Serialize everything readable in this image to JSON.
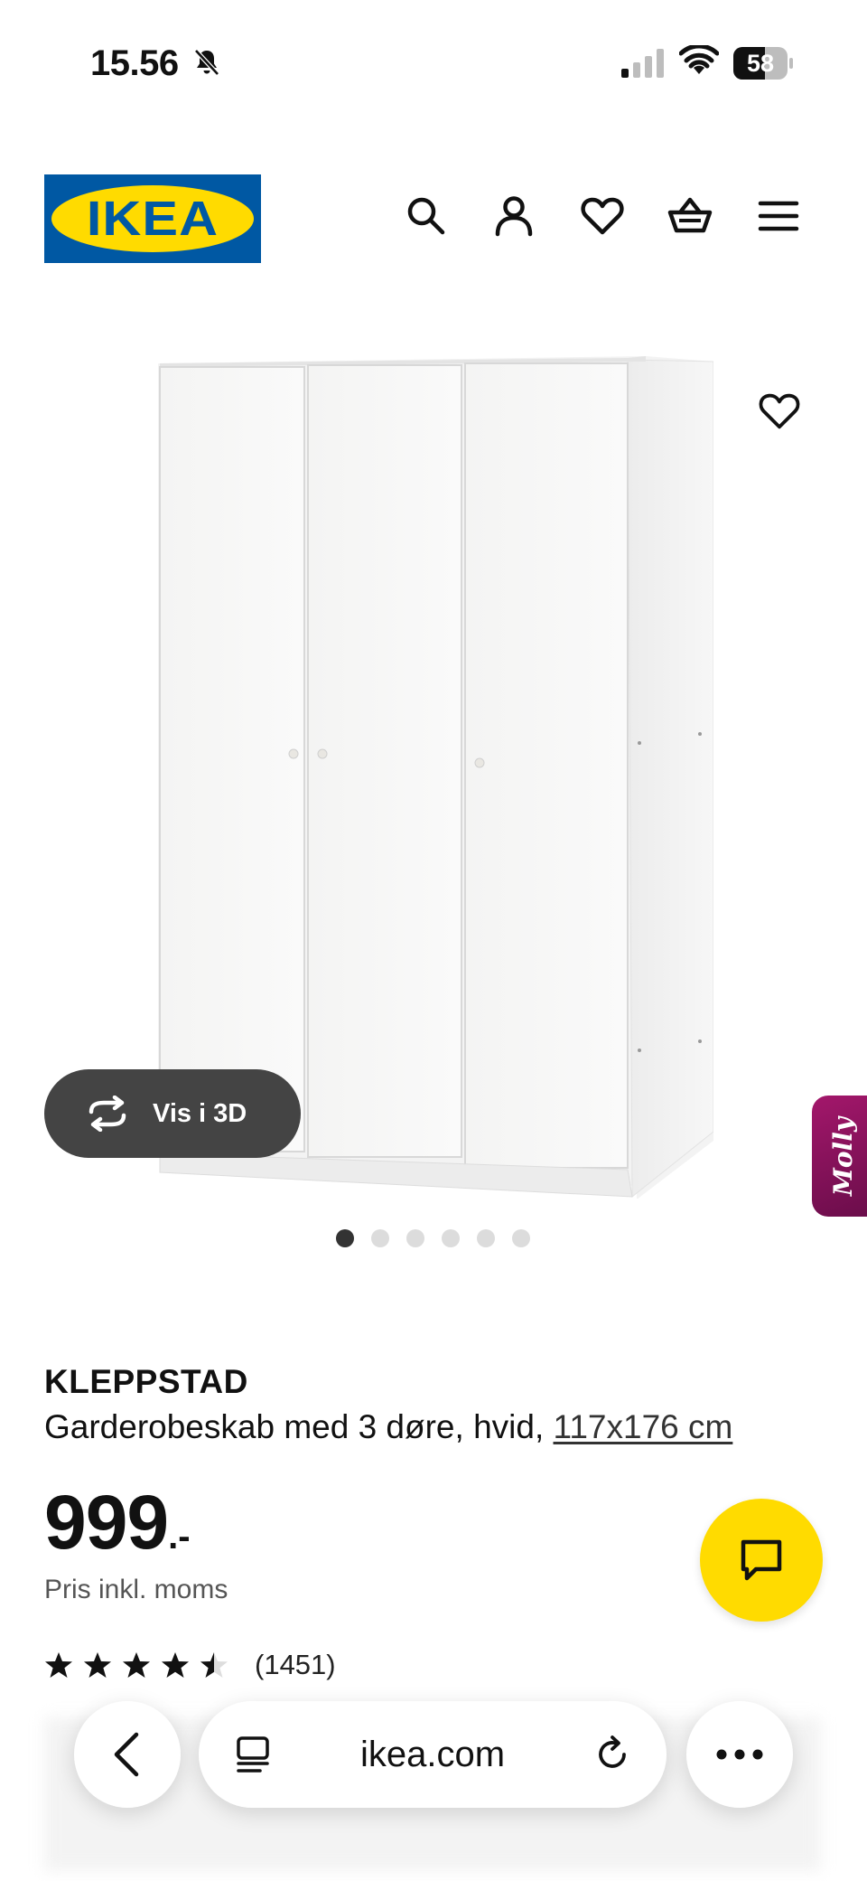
{
  "status_bar": {
    "time": "15.56",
    "battery": "58",
    "battery_level": 0.58,
    "icons": [
      "bell-slash-icon",
      "signal-icon",
      "wifi-icon",
      "battery-icon"
    ]
  },
  "header": {
    "logo_text": "IKEA",
    "icons": [
      "search-icon",
      "account-icon",
      "heart-icon",
      "basket-icon",
      "menu-icon"
    ]
  },
  "gallery": {
    "view_3d_label": "Vis i 3D",
    "assistant_label": "Molly",
    "image_count": 6,
    "active_image_index": 0
  },
  "product": {
    "name": "KLEPPSTAD",
    "description": "Garderobeskab med 3 døre, hvid,",
    "size": "117x176 cm",
    "price": "999",
    "price_suffix": ".-",
    "price_note": "Pris inkl. moms",
    "rating": 4.5,
    "rating_max": 5,
    "rating_count": "(1451)"
  },
  "browser": {
    "url": "ikea.com",
    "icons": [
      "back-icon",
      "tabs-icon",
      "reload-icon",
      "more-icon"
    ]
  },
  "colors": {
    "ikea_blue": "#0058a3",
    "ikea_yellow": "#ffdb00",
    "molly_magenta": "#a3176b",
    "view3d_bg": "#444444"
  }
}
